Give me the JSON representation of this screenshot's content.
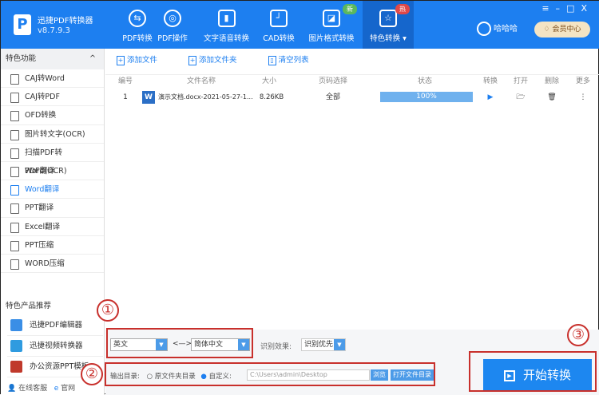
{
  "app": {
    "name": "迅捷PDF转换器",
    "version": "v8.7.9.3",
    "user": "哈哈哈",
    "vip": "会员中心"
  },
  "nav": [
    {
      "label": "PDF转换"
    },
    {
      "label": "PDF操作"
    },
    {
      "label": "文字语音转换"
    },
    {
      "label": "CAD转换"
    },
    {
      "label": "图片格式转换",
      "badge": "新"
    },
    {
      "label": "特色转换",
      "badge": "热"
    }
  ],
  "sidebar": {
    "title": "特色功能",
    "items": [
      "CAJ转Word",
      "CAJ转PDF",
      "OFD转换",
      "图片转文字(OCR)",
      "扫描PDF转Word(OCR)",
      "PDF翻译",
      "Word翻译",
      "PPT翻译",
      "Excel翻译",
      "PPT压缩",
      "WORD压缩"
    ],
    "products_title": "特色产品推荐",
    "products": [
      "迅捷PDF编辑器",
      "迅捷视频转换器",
      "办公资源PPT模板"
    ],
    "footer": [
      "在线客服",
      "官网"
    ]
  },
  "toolbar": {
    "add_file": "添加文件",
    "add_folder": "添加文件夹",
    "clear": "清空列表"
  },
  "table": {
    "headers": [
      "编号",
      "文件名称",
      "大小",
      "页码选择",
      "状态",
      "转换",
      "打开",
      "删除",
      "更多"
    ],
    "rows": [
      {
        "index": "1",
        "name": "演示文档.docx-2021-05-27-1...",
        "size": "8.26KB",
        "pages": "全部",
        "status": "100%",
        "progress": 100
      }
    ]
  },
  "options": {
    "from_lang": "英文",
    "arrow": "<—>",
    "to_lang": "简体中文",
    "effect_label": "识别效果:",
    "effect": "识别优先",
    "output_label": "输出目录:",
    "radio_original": "原文件夹目录",
    "radio_custom": "自定义:",
    "path": "C:\\Users\\admin\\Desktop",
    "browse": "浏览",
    "open_dir": "打开文件目录"
  },
  "start": "开始转换",
  "annotations": [
    "①",
    "②",
    "③"
  ]
}
